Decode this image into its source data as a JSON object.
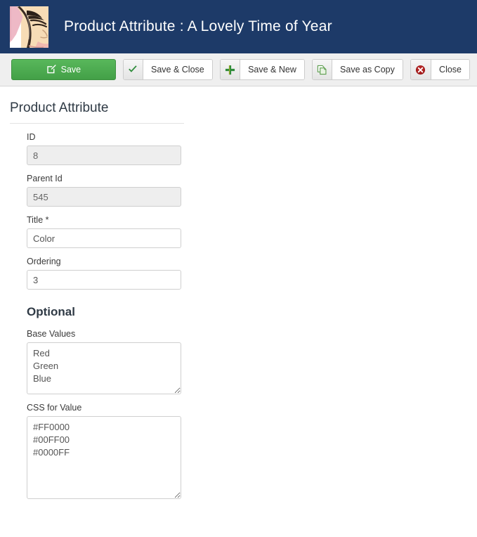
{
  "header": {
    "title": "Product Attribute : A Lovely Time of Year",
    "logo_icon": "avatar-face-illustration",
    "background_color": "#1d3a68"
  },
  "toolbar": {
    "buttons": [
      {
        "label": "Save",
        "icon": "pencil-square-icon",
        "style": "primary",
        "color": "#43a047"
      },
      {
        "label": "Save & Close",
        "icon": "check-icon",
        "style": "default",
        "color": "#2f8c3b"
      },
      {
        "label": "Save & New",
        "icon": "plus-icon",
        "style": "default",
        "color": "#2f8c3b"
      },
      {
        "label": "Save as Copy",
        "icon": "copy-pages-icon",
        "style": "default",
        "color": "#5d9e4f"
      },
      {
        "label": "Close",
        "icon": "circle-x-icon",
        "style": "default",
        "color": "#a01b1b"
      }
    ]
  },
  "form": {
    "legend": "Product Attribute",
    "optional_heading": "Optional",
    "fields": [
      {
        "label": "ID",
        "value": "8",
        "readonly": true
      },
      {
        "label": "Parent Id",
        "value": "545",
        "readonly": true
      },
      {
        "label": "Title *",
        "value": "Color",
        "readonly": false
      },
      {
        "label": "Ordering",
        "value": "3",
        "readonly": false
      }
    ],
    "textareas": [
      {
        "label": "Base Values",
        "value": "Red\nGreen\nBlue"
      },
      {
        "label": "CSS for Value",
        "value": "#FF0000\n#00FF00\n#0000FF"
      }
    ]
  }
}
